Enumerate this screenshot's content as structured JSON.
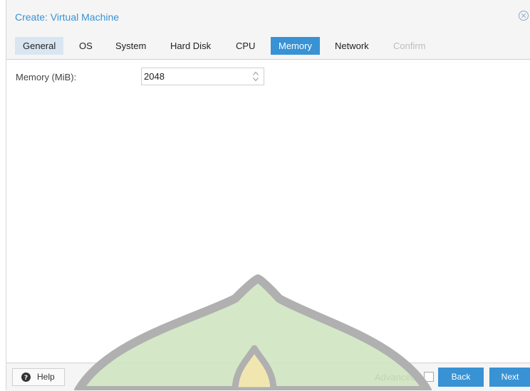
{
  "window": {
    "title": "Create: Virtual Machine",
    "close_icon": "close-circle-icon"
  },
  "tabs": [
    {
      "label": "General",
      "state": "inactive"
    },
    {
      "label": "OS",
      "state": "normal"
    },
    {
      "label": "System",
      "state": "normal"
    },
    {
      "label": "Hard Disk",
      "state": "normal"
    },
    {
      "label": "CPU",
      "state": "normal"
    },
    {
      "label": "Memory",
      "state": "active"
    },
    {
      "label": "Network",
      "state": "normal"
    },
    {
      "label": "Confirm",
      "state": "disabled"
    }
  ],
  "memory": {
    "label": "Memory (MiB):",
    "value": "2048"
  },
  "footer": {
    "help_label": "Help",
    "advanced_label": "Advanced",
    "advanced_checked": false,
    "back_label": "Back",
    "next_label": "Next"
  },
  "colors": {
    "accent": "#3892d4",
    "tab_inactive_bg": "#d9e6f2",
    "title_text": "#3892d4",
    "watermark_gray": "#b0b0b0",
    "watermark_green": "#cfe6c2",
    "watermark_yellow": "#f2e6b0"
  }
}
